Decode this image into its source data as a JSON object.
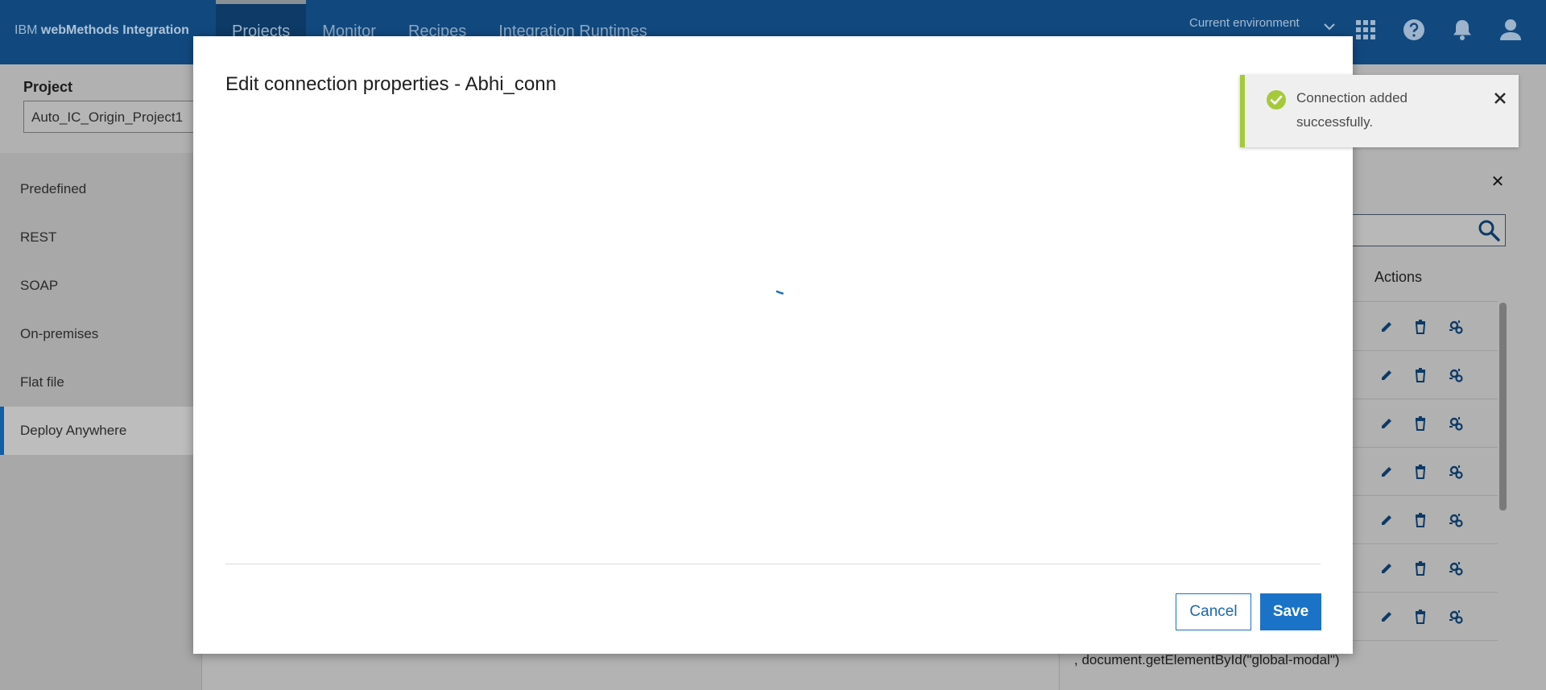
{
  "topbar": {
    "brand_prefix": "IBM",
    "brand_name": "webMethods Integration",
    "nav": [
      {
        "label": "Projects",
        "active": true
      },
      {
        "label": "Monitor"
      },
      {
        "label": "Recipes"
      },
      {
        "label": "Integration Runtimes"
      }
    ],
    "environment_label": "Current environment",
    "icons": [
      "chevron-down-icon",
      "app-grid-icon",
      "help-icon",
      "notification-bell-icon",
      "user-avatar-icon"
    ]
  },
  "project": {
    "label": "Project",
    "value": "Auto_IC_Origin_Project1"
  },
  "sidebar": {
    "items": [
      {
        "label": "Predefined"
      },
      {
        "label": "REST"
      },
      {
        "label": "SOAP"
      },
      {
        "label": "On-premises"
      },
      {
        "label": "Flat file"
      },
      {
        "label": "Deploy Anywhere",
        "active": true
      }
    ]
  },
  "right_panel": {
    "actions_header": "Actions",
    "row_icons": [
      "edit-pencil-icon",
      "delete-trash-icon",
      "configure-gear-icon"
    ],
    "debug_text": ", document.getElementById(\"global-modal\")"
  },
  "modal": {
    "title": "Edit connection properties - Abhi_conn",
    "cancel_label": "Cancel",
    "save_label": "Save",
    "loading": true
  },
  "toast": {
    "message": "Connection added successfully.",
    "status": "success",
    "accent_color": "#a6c93c"
  },
  "colors": {
    "header_bg": "#11497f",
    "primary_button": "#1a73c7",
    "active_nav_border": "#0f5ea8"
  }
}
